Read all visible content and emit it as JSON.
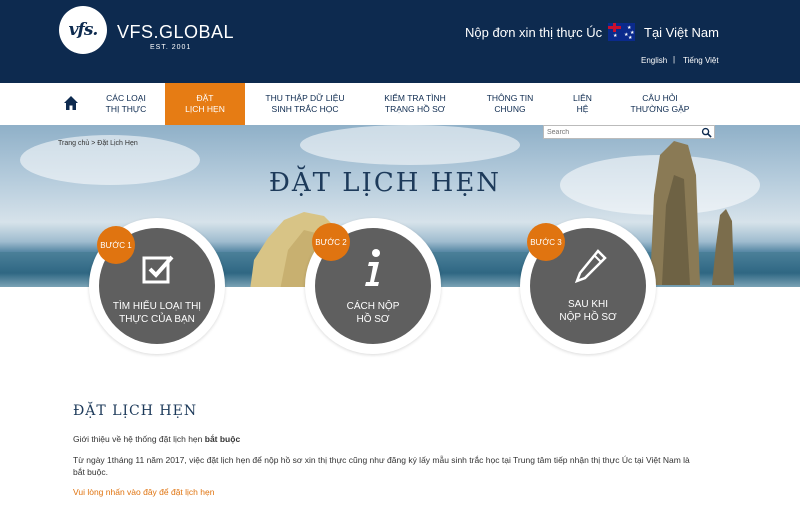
{
  "brand": {
    "logo_text": "vfs.",
    "name": "VFS.GLOBAL",
    "tagline": "EST. 2001"
  },
  "header": {
    "title": "Nộp đơn xin thị thực Úc",
    "country": "Tại Việt Nam",
    "languages": [
      "English",
      "Tiếng Việt"
    ],
    "separator": "|"
  },
  "nav": {
    "items": [
      {
        "line1": "CÁC LOẠI",
        "line2": "THỊ THỰC"
      },
      {
        "line1": "ĐẶT",
        "line2": "LỊCH HẸN"
      },
      {
        "line1": "THU THẬP DỮ LIỆU",
        "line2": "SINH TRẮC HỌC"
      },
      {
        "line1": "KIỂM TRA TÌNH",
        "line2": "TRẠNG HỒ SƠ"
      },
      {
        "line1": "THÔNG TIN",
        "line2": "CHUNG"
      },
      {
        "line1": "LIÊN",
        "line2": "HỆ"
      },
      {
        "line1": "CÂU HỎI",
        "line2": "THƯỜNG GẶP"
      }
    ]
  },
  "search": {
    "placeholder": "Search"
  },
  "breadcrumb": {
    "home": "Trang chủ",
    "sep": ">",
    "current": "Đặt Lịch Hẹn"
  },
  "hero": {
    "title": "ĐẶT LỊCH HẸN"
  },
  "steps": [
    {
      "badge": "BƯỚC 1",
      "line1": "TÌM HIỂU LOẠI THỊ",
      "line2": "THỰC CỦA BẠN",
      "icon": "checkbox-icon"
    },
    {
      "badge": "BƯỚC 2",
      "line1": "CÁCH NỘP",
      "line2": "HỒ SƠ",
      "icon": "info-icon"
    },
    {
      "badge": "BƯỚC 3",
      "line1": "SAU KHI",
      "line2": "NỘP HỒ SƠ",
      "icon": "pencil-icon"
    }
  ],
  "content": {
    "title": "ĐẶT LỊCH HẸN",
    "intro_prefix": "Giới thiệu về hệ thống đặt lịch hẹn ",
    "intro_bold": "bắt buộc",
    "paragraph": "Từ ngày 1tháng 11 năm 2017, việc đặt lịch hẹn để nộp hồ sơ xin thị thực cũng như đăng ký lấy mẫu sinh trắc học tại Trung tâm tiếp nhận thị thực Úc tại Việt Nam là bắt buộc.",
    "link": "Vui lòng nhấn vào đây để đặt lịch hẹn"
  },
  "colors": {
    "header_bg": "#0d2a4f",
    "accent": "#e67c14",
    "step_bg": "#5f5f5f"
  }
}
